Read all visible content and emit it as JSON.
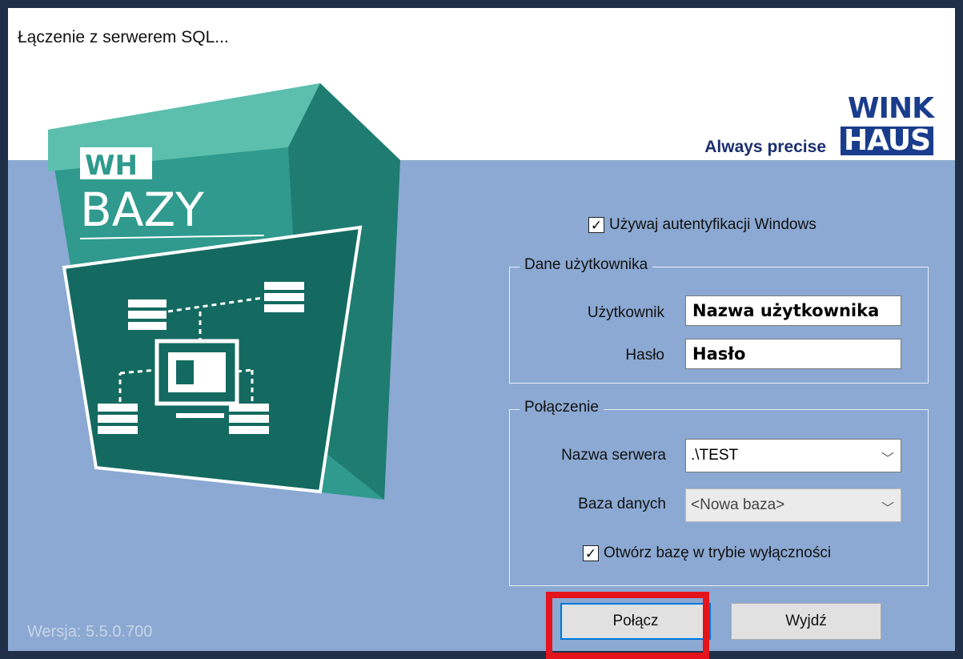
{
  "window": {
    "title": "Łączenie z serwerem SQL..."
  },
  "logo": {
    "tagline": "Always precise",
    "brand_line1": "WINK",
    "brand_line2": "HAUS"
  },
  "box_art": {
    "label_wh": "WH",
    "label_bazy": "BAZY"
  },
  "auth": {
    "windows_auth_label": "Używaj autentyfikacji Windows",
    "windows_auth_checked": true
  },
  "user_group": {
    "title": "Dane użytkownika",
    "user_label": "Użytkownik",
    "user_value": "Nazwa użytkownika",
    "password_label": "Hasło",
    "password_value": "Hasło"
  },
  "connection_group": {
    "title": "Połączenie",
    "server_label": "Nazwa serwera",
    "server_value": ".\\TEST",
    "database_label": "Baza danych",
    "database_value": "<Nowa baza>",
    "exclusive_label": "Otwórz bazę w trybie wyłączności",
    "exclusive_checked": true
  },
  "buttons": {
    "connect": "Połącz",
    "exit": "Wyjdź"
  },
  "footer": {
    "version": "Wersja: 5.5.0.700"
  },
  "colors": {
    "panel_bg": "#8ba9d2",
    "highlight": "#e3141b",
    "box_teal": "#2f9a8d",
    "brand_blue": "#1a3c8c"
  }
}
